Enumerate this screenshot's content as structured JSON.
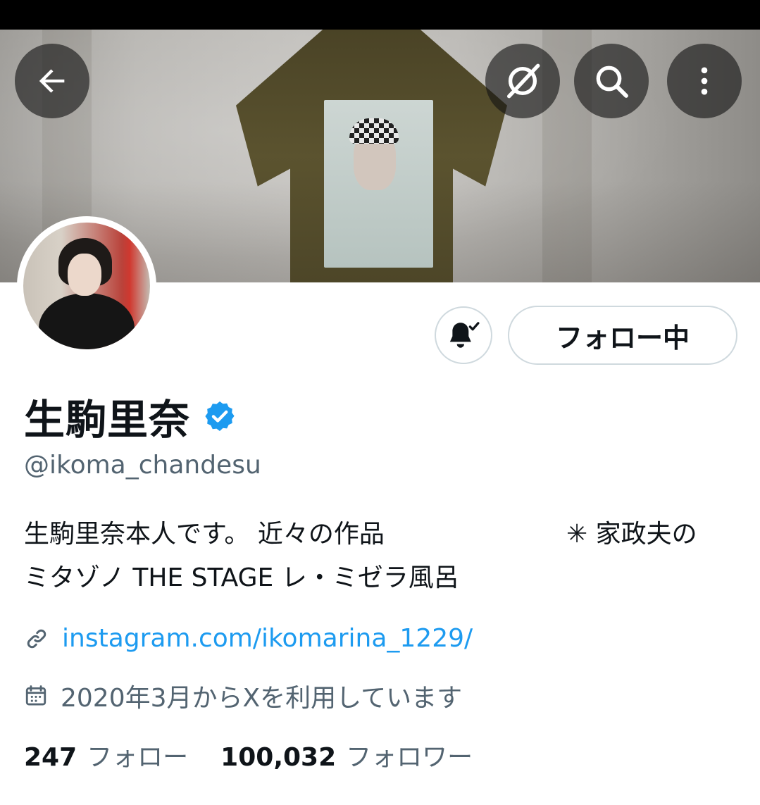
{
  "profile": {
    "display_name": "生駒里奈",
    "handle": "@ikoma_chandesu",
    "verified": true,
    "bio_line1_left": "生駒里奈本人です。 近々の作品",
    "bio_line1_right": "✳ 家政夫の",
    "bio_line2": "ミタゾノ THE STAGE レ・ミゼラ風呂",
    "link": "instagram.com/ikomarina_1229/",
    "joined": "2020年3月からXを利用しています"
  },
  "actions": {
    "following_label": "フォロー中"
  },
  "stats": {
    "following_count": "247",
    "following_label": "フォロー",
    "followers_count": "100,032",
    "followers_label": "フォロワー"
  },
  "icons": {
    "back": "arrow-left-icon",
    "grok": "grok-icon",
    "search": "search-icon",
    "more": "more-vertical-icon",
    "bell": "bell-subscribed-icon",
    "verified": "verified-badge-icon",
    "link": "link-icon",
    "calendar": "calendar-icon"
  },
  "colors": {
    "accent": "#1d9bf0",
    "secondary_text": "#536471",
    "primary_text": "#0f1419"
  }
}
